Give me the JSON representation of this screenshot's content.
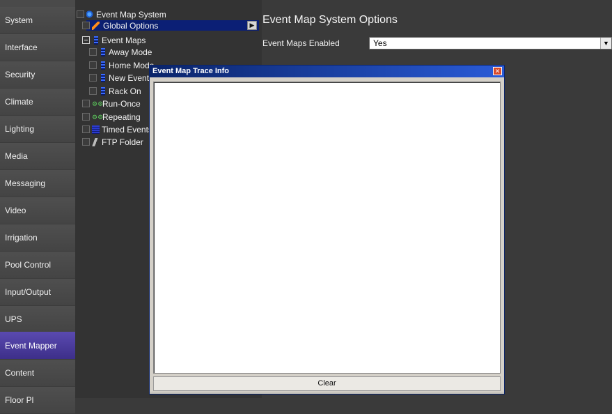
{
  "nav": {
    "items": [
      {
        "label": "System"
      },
      {
        "label": "Interface"
      },
      {
        "label": "Security"
      },
      {
        "label": "Climate"
      },
      {
        "label": "Lighting"
      },
      {
        "label": "Media"
      },
      {
        "label": "Messaging"
      },
      {
        "label": "Video"
      },
      {
        "label": "Irrigation"
      },
      {
        "label": "Pool Control"
      },
      {
        "label": "Input/Output"
      },
      {
        "label": "UPS"
      },
      {
        "label": "Event Mapper"
      },
      {
        "label": "Content"
      },
      {
        "label": "Floor Pl"
      }
    ],
    "active": "Event Mapper"
  },
  "tree": {
    "root": "Event Map System",
    "global_options": "Global Options",
    "event_maps": "Event Maps",
    "maps": [
      "Away Mode",
      "Home Mode",
      "New Event Map",
      "Rack On"
    ],
    "run_once": "Run-Once",
    "repeating": "Repeating",
    "timed": "Timed Events",
    "ftp": "FTP Folder"
  },
  "options": {
    "title": "Event Map System Options",
    "field_label": "Event Maps Enabled",
    "field_value": "Yes"
  },
  "dialog": {
    "title": "Event Map Trace Info",
    "clear_label": "Clear",
    "close_glyph": "✕"
  }
}
